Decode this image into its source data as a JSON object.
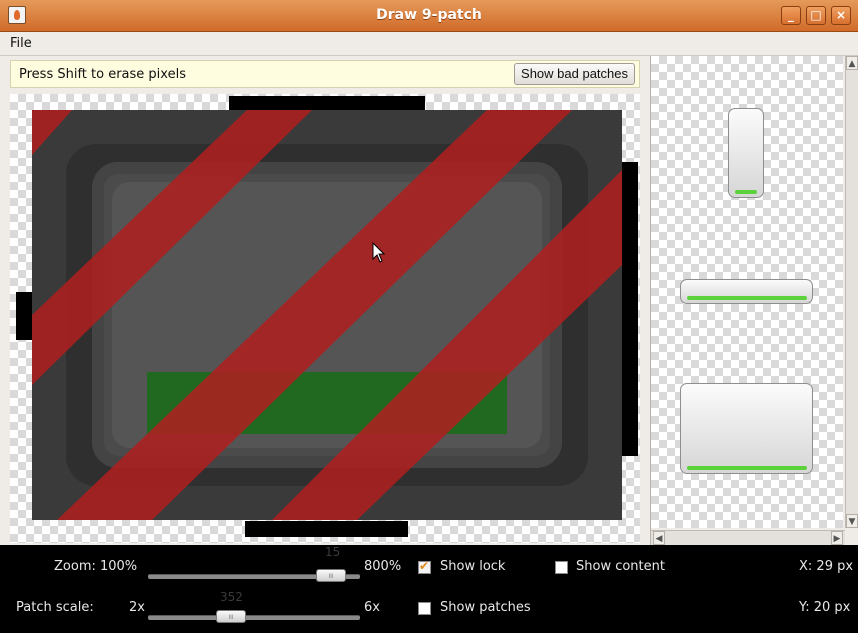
{
  "window": {
    "title": "Draw 9-patch",
    "minimize_glyph": "_",
    "maximize_glyph": "□",
    "close_glyph": "×"
  },
  "menu": {
    "file_label": "File"
  },
  "hint": {
    "text": "Press Shift to erase pixels",
    "bad_patches_button": "Show bad patches"
  },
  "controls": {
    "zoom_label": "Zoom: 100%",
    "zoom_max_label": "800%",
    "zoom_value": "15",
    "patch_scale_label": "Patch scale:",
    "patch_min_label": "2x",
    "patch_max_label": "6x",
    "patch_value": "352",
    "show_lock_label": "Show lock",
    "show_lock_checked": true,
    "show_content_label": "Show content",
    "show_content_checked": false,
    "show_patches_label": "Show patches",
    "show_patches_checked": false,
    "x_readout": "X: 29 px",
    "y_readout": "Y: 20 px"
  },
  "colors": {
    "titlebar": "#d97a3a",
    "bad_patch_red": "#b01e1e",
    "content_green": "#1e7a1e",
    "preview_green": "#5cd23a"
  },
  "icons": {
    "app": "java-cup-icon",
    "cursor": "mouse-pointer-icon",
    "scroll_up": "chevron-up-icon",
    "scroll_down": "chevron-down-icon",
    "scroll_left": "chevron-left-icon",
    "scroll_right": "chevron-right-icon"
  }
}
